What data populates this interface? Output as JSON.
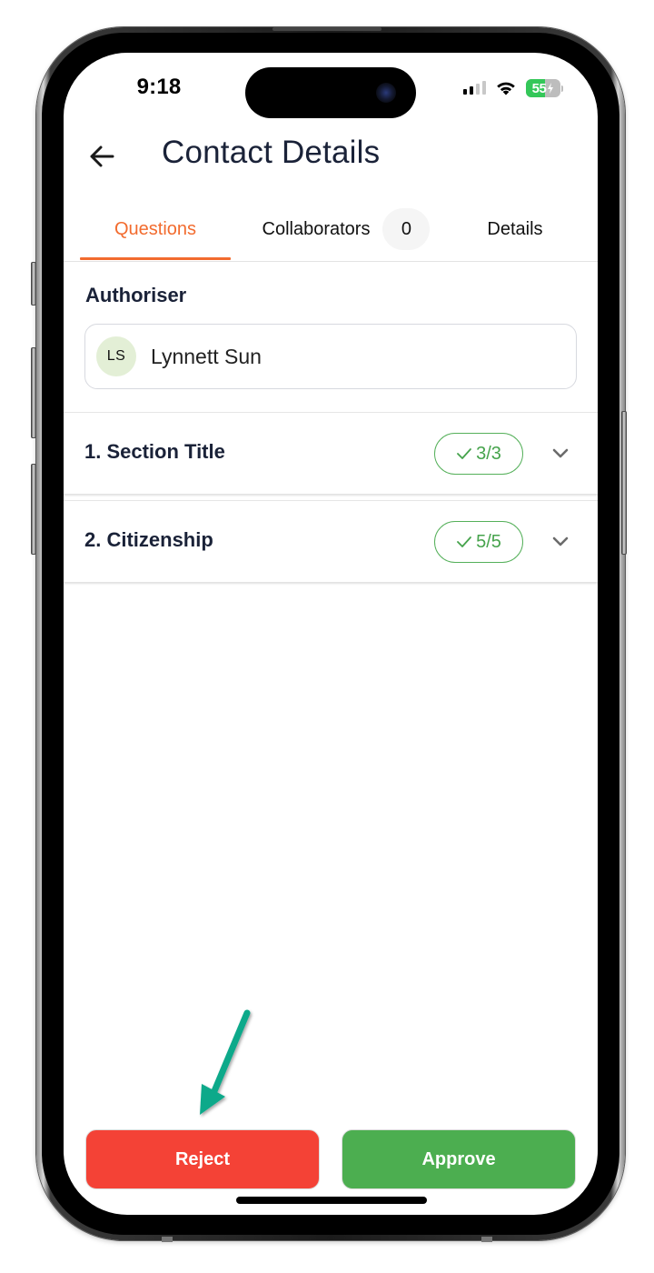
{
  "status_bar": {
    "time": "9:18",
    "battery_percent": "55",
    "battery_level": 0.55,
    "signal_bars_active": 2,
    "signal_bars_total": 4,
    "icons": [
      "cellular-signal-icon",
      "wifi-icon",
      "battery-charging-icon"
    ]
  },
  "header": {
    "back_icon": "arrow-left-icon",
    "title": "Contact Details"
  },
  "tabs": [
    {
      "label": "Questions",
      "active": true
    },
    {
      "label": "Collaborators",
      "badge": "0",
      "active": false
    },
    {
      "label": "Details",
      "active": false
    }
  ],
  "authoriser": {
    "label": "Authoriser",
    "avatar_initials": "LS",
    "name": "Lynnett Sun"
  },
  "sections": [
    {
      "title": "1. Section Title",
      "progress": "3/3",
      "progress_icon": "check-icon",
      "expand_icon": "chevron-down-icon"
    },
    {
      "title": "2. Citizenship",
      "progress": "5/5",
      "progress_icon": "check-icon",
      "expand_icon": "chevron-down-icon"
    }
  ],
  "actions": {
    "reject_label": "Reject",
    "approve_label": "Approve"
  },
  "annotation": {
    "icon": "arrow-pointer-icon",
    "color": "#0aa98a",
    "target": "Reject"
  },
  "colors": {
    "accent": "#f26b2e",
    "success": "#4cae50",
    "danger": "#f44236",
    "title_text": "#1a2238"
  }
}
